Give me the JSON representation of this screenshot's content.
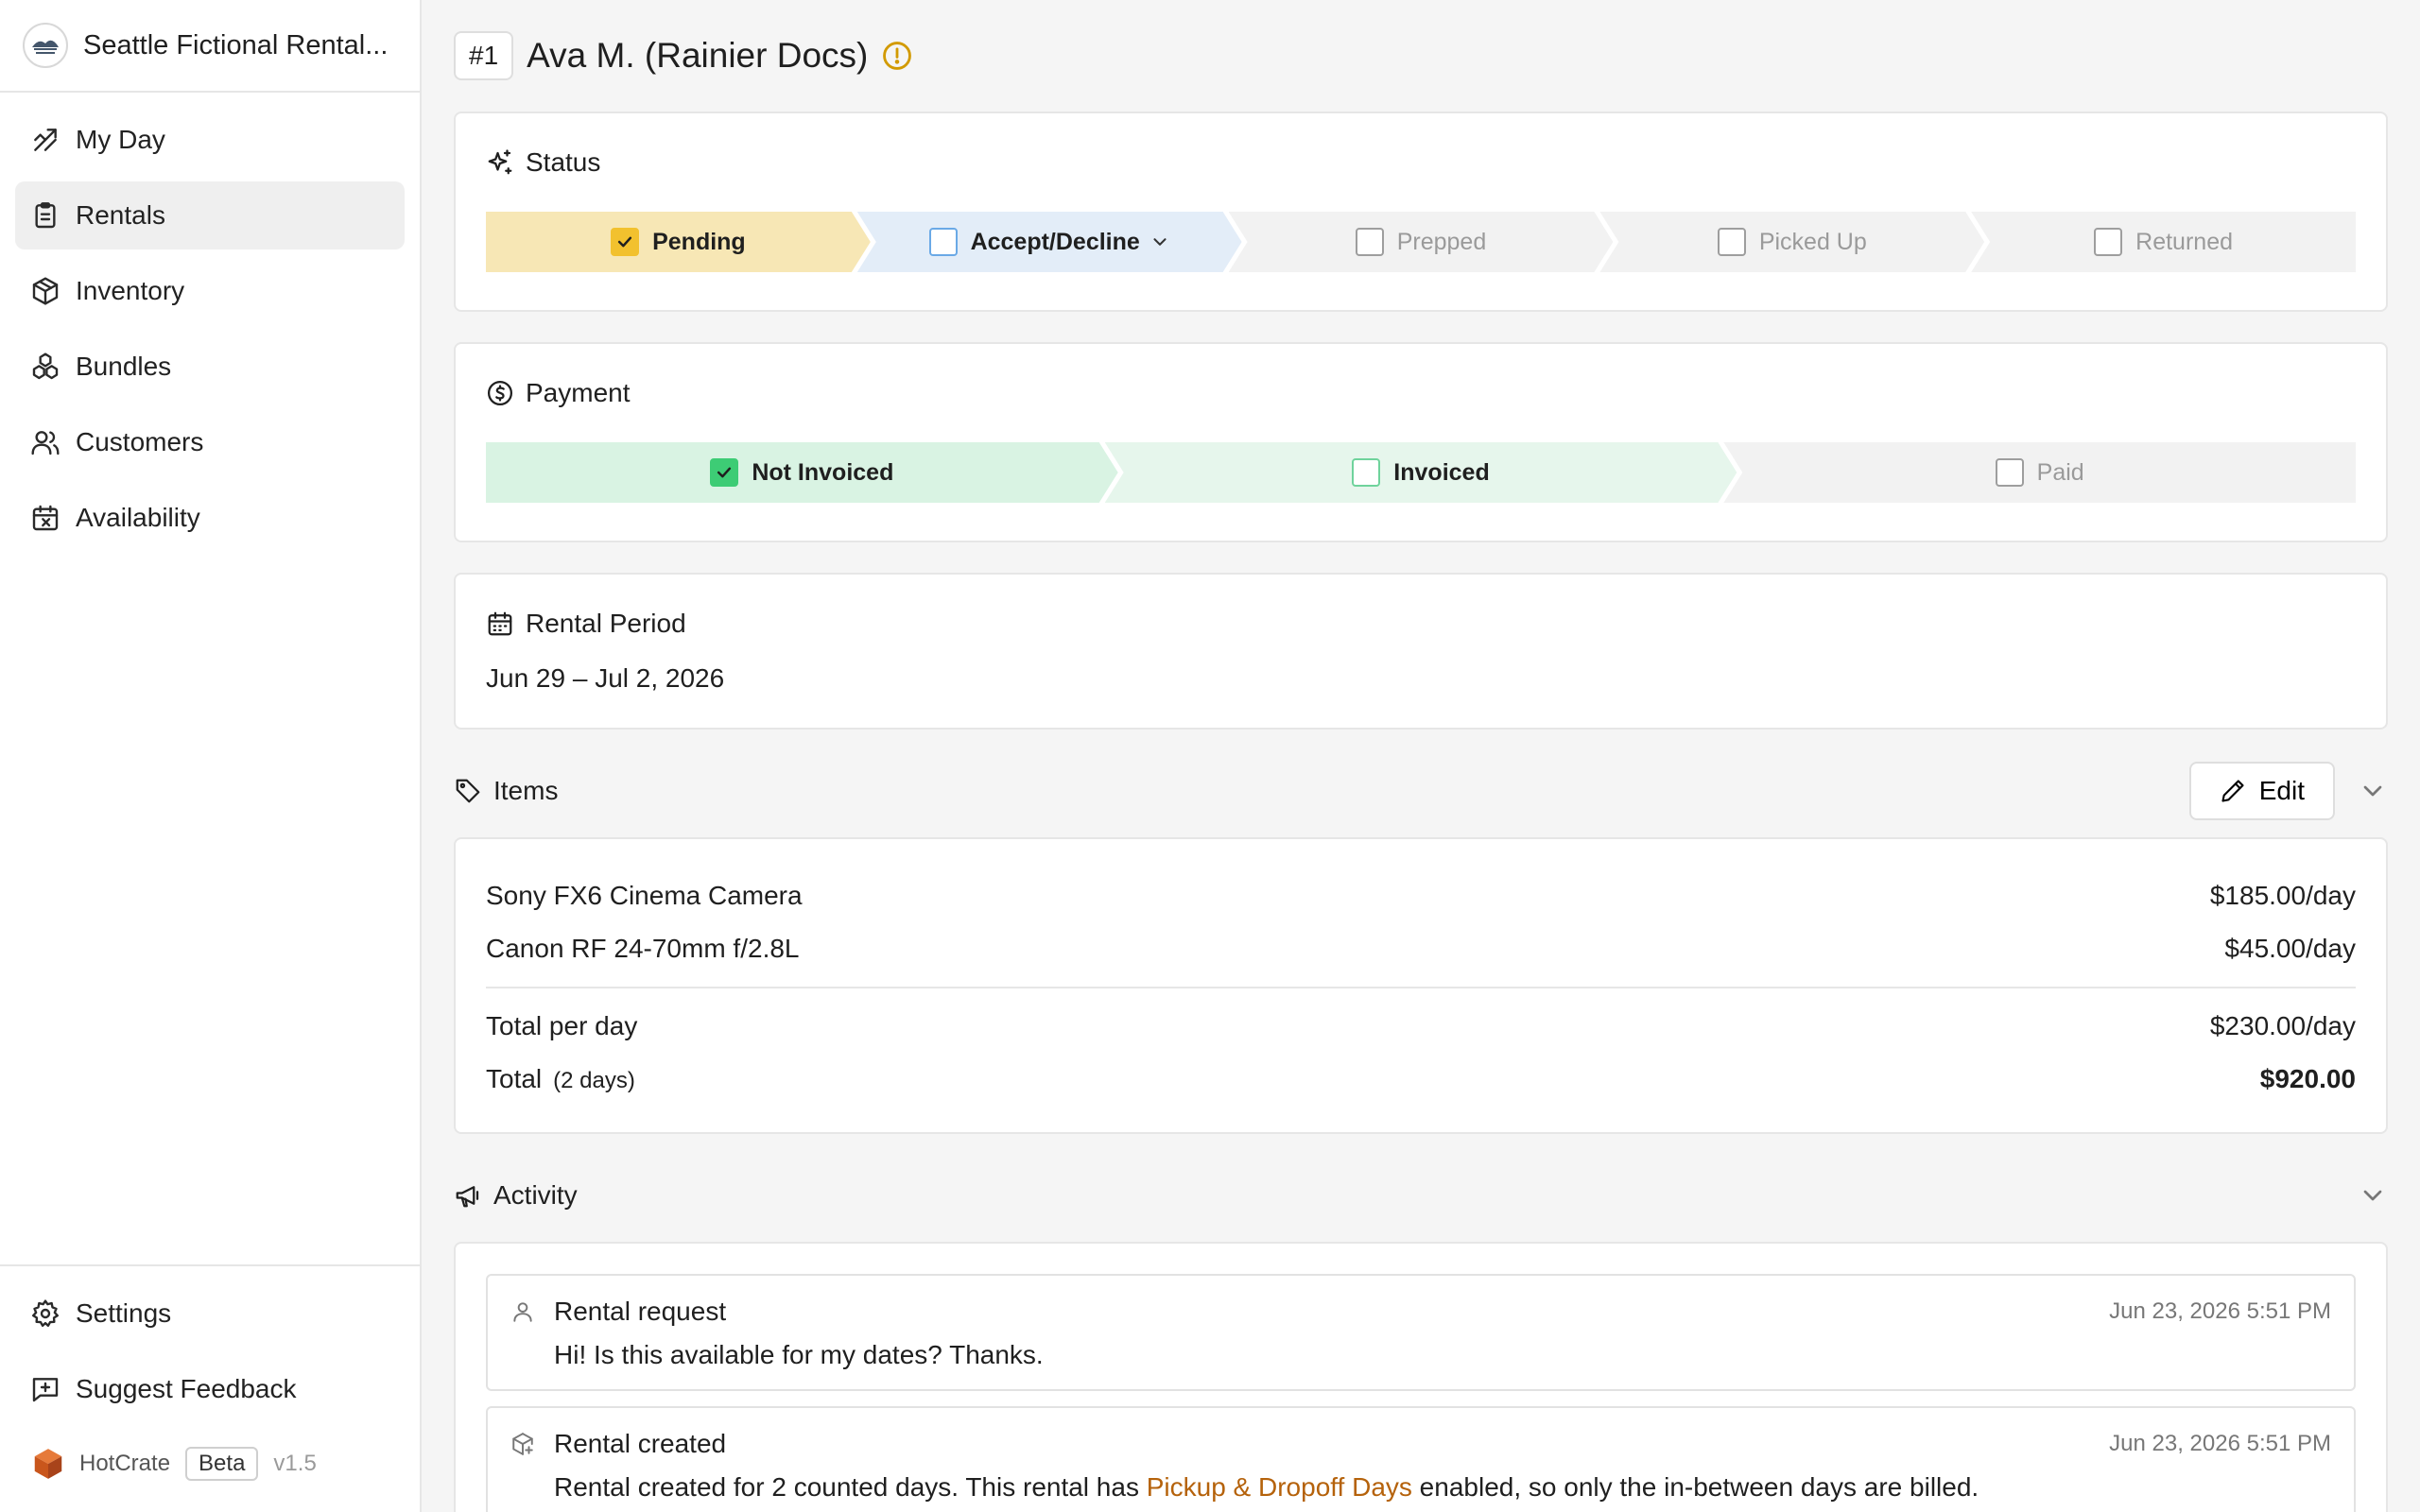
{
  "sidebar": {
    "org_name": "Seattle Fictional Rental...",
    "items": [
      {
        "label": "My Day",
        "icon": "trend-arrow-icon"
      },
      {
        "label": "Rentals",
        "icon": "clipboard-icon"
      },
      {
        "label": "Inventory",
        "icon": "box-icon"
      },
      {
        "label": "Bundles",
        "icon": "boxes-icon"
      },
      {
        "label": "Customers",
        "icon": "users-icon"
      },
      {
        "label": "Availability",
        "icon": "calendar-x-icon"
      }
    ],
    "active": "Rentals",
    "bottom": [
      {
        "label": "Settings",
        "icon": "gear-icon"
      },
      {
        "label": "Suggest Feedback",
        "icon": "feedback-plus-icon"
      }
    ],
    "brand": {
      "name": "HotCrate",
      "badge": "Beta",
      "version": "v1.5"
    }
  },
  "header": {
    "number": "#1",
    "title": "Ava M. (Rainier Docs)"
  },
  "status": {
    "title": "Status",
    "steps": [
      "Pending",
      "Accept/Decline",
      "Prepped",
      "Picked Up",
      "Returned"
    ],
    "current": "Pending"
  },
  "payment": {
    "title": "Payment",
    "steps": [
      "Not Invoiced",
      "Invoiced",
      "Paid"
    ],
    "current": "Not Invoiced"
  },
  "period": {
    "title": "Rental Period",
    "value": "Jun 29 – Jul 2, 2026"
  },
  "items": {
    "title": "Items",
    "edit_label": "Edit",
    "lines": [
      {
        "name": "Sony FX6 Cinema Camera",
        "price": "$185.00/day"
      },
      {
        "name": "Canon RF 24-70mm f/2.8L",
        "price": "$45.00/day"
      }
    ],
    "total_per_day_label": "Total per day",
    "total_per_day": "$230.00/day",
    "total_label": "Total",
    "total_days": "(2 days)",
    "total": "$920.00"
  },
  "activity": {
    "title": "Activity",
    "entries": [
      {
        "title": "Rental request",
        "time": "Jun 23, 2026 5:51 PM",
        "body": "Hi! Is this available for my dates? Thanks."
      },
      {
        "title": "Rental created",
        "time": "Jun 23, 2026 5:51 PM",
        "body_pre": "Rental created for 2 counted days. This rental has ",
        "body_link": "Pickup & Dropoff Days",
        "body_post": " enabled, so only the in-between days are billed."
      }
    ]
  },
  "colors": {
    "accent_link": "#b5620b",
    "pending": "#f7e7b5",
    "accept": "#e3edf8",
    "not_invoiced": "#d9f3e3",
    "warning": "#d29a00"
  }
}
